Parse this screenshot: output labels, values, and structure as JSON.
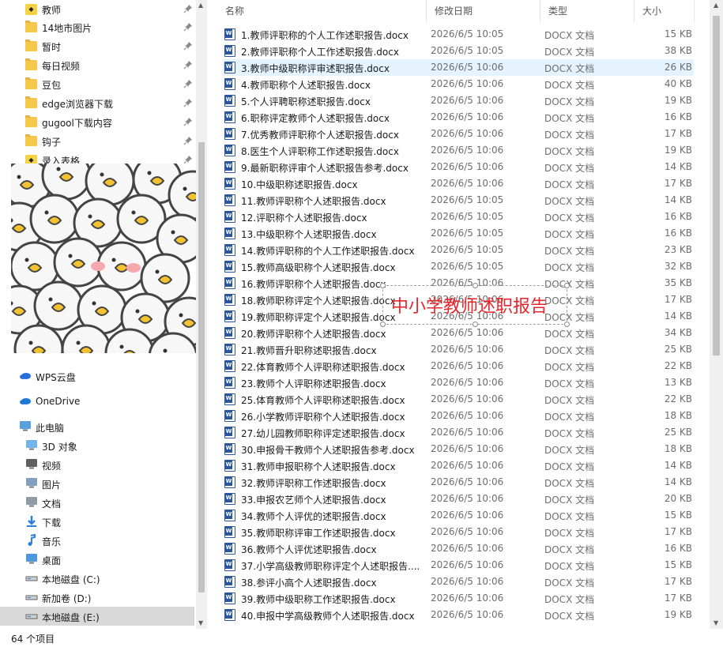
{
  "quick_access": [
    {
      "label": "教师",
      "icon": "app-icon"
    },
    {
      "label": "14地市图片",
      "icon": "folder-icon"
    },
    {
      "label": "暂时",
      "icon": "folder-icon"
    },
    {
      "label": "每日视频",
      "icon": "folder-icon"
    },
    {
      "label": "豆包",
      "icon": "folder-icon"
    },
    {
      "label": "edge浏览器下载",
      "icon": "folder-icon"
    },
    {
      "label": "gugool下载内容",
      "icon": "folder-icon"
    },
    {
      "label": "钩子",
      "icon": "folder-icon"
    },
    {
      "label": "录入表格",
      "icon": "app-icon"
    }
  ],
  "tree": [
    {
      "label": "WPS云盘",
      "icon": "wps-cloud-icon",
      "indent": 1
    },
    {
      "label": "OneDrive",
      "icon": "onedrive-icon",
      "indent": 1
    },
    {
      "label": "此电脑",
      "icon": "this-pc-icon",
      "indent": 1
    },
    {
      "label": "3D 对象",
      "icon": "3d-objects-icon",
      "indent": 2
    },
    {
      "label": "视频",
      "icon": "videos-icon",
      "indent": 2
    },
    {
      "label": "图片",
      "icon": "pictures-icon",
      "indent": 2
    },
    {
      "label": "文档",
      "icon": "documents-icon",
      "indent": 2
    },
    {
      "label": "下载",
      "icon": "downloads-icon",
      "indent": 2
    },
    {
      "label": "音乐",
      "icon": "music-icon",
      "indent": 2
    },
    {
      "label": "桌面",
      "icon": "desktop-icon",
      "indent": 2
    },
    {
      "label": "本地磁盘 (C:)",
      "icon": "drive-c-icon",
      "indent": 2
    },
    {
      "label": "新加卷 (D:)",
      "icon": "drive-d-icon",
      "indent": 2
    },
    {
      "label": "本地磁盘 (E:)",
      "icon": "drive-e-icon",
      "indent": 2,
      "selected": true
    }
  ],
  "columns": {
    "name": "名称",
    "date": "修改日期",
    "type": "类型",
    "size": "大小"
  },
  "files": [
    {
      "name": "1.教师评职称的个人工作述职报告.docx",
      "date": "2026/6/5 10:05",
      "type": "DOCX 文档",
      "size": "15 KB"
    },
    {
      "name": "2.教师评职称个人工作述职报告.docx",
      "date": "2026/6/5 10:05",
      "type": "DOCX 文档",
      "size": "38 KB"
    },
    {
      "name": "3.教师中级职称评审述职报告.docx",
      "date": "2026/6/5 10:06",
      "type": "DOCX 文档",
      "size": "26 KB",
      "selected": true
    },
    {
      "name": "4.教师职称个人述职报告.docx",
      "date": "2026/6/5 10:06",
      "type": "DOCX 文档",
      "size": "40 KB"
    },
    {
      "name": "5.个人评聘职称述职报告.docx",
      "date": "2026/6/5 10:06",
      "type": "DOCX 文档",
      "size": "19 KB"
    },
    {
      "name": "6.职称评定教师个人述职报告.docx",
      "date": "2026/6/5 10:06",
      "type": "DOCX 文档",
      "size": "16 KB"
    },
    {
      "name": "7.优秀教师评职称个人述职报告.docx",
      "date": "2026/6/5 10:06",
      "type": "DOCX 文档",
      "size": "17 KB"
    },
    {
      "name": "8.医生个人评职称工作述职报告.docx",
      "date": "2026/6/5 10:06",
      "type": "DOCX 文档",
      "size": "19 KB"
    },
    {
      "name": "9.最新职称评审个人述职报告参考.docx",
      "date": "2026/6/5 10:06",
      "type": "DOCX 文档",
      "size": "14 KB"
    },
    {
      "name": "10.中级职称述职报告.docx",
      "date": "2026/6/5 10:06",
      "type": "DOCX 文档",
      "size": "17 KB"
    },
    {
      "name": "11.教师评职称个人述职报告.docx",
      "date": "2026/6/5 10:05",
      "type": "DOCX 文档",
      "size": "14 KB"
    },
    {
      "name": "12.评职称个人述职报告.docx",
      "date": "2026/6/5 10:05",
      "type": "DOCX 文档",
      "size": "16 KB"
    },
    {
      "name": "13.中级职称个人述职报告.docx",
      "date": "2026/6/5 10:05",
      "type": "DOCX 文档",
      "size": "16 KB"
    },
    {
      "name": "14.教师评职称的个人工作述职报告.docx",
      "date": "2026/6/5 10:05",
      "type": "DOCX 文档",
      "size": "23 KB"
    },
    {
      "name": "15.教师高级职称个人述职报告.docx",
      "date": "2026/6/5 10:05",
      "type": "DOCX 文档",
      "size": "32 KB"
    },
    {
      "name": "16.教师评职称个人述职报告.docx",
      "date": "2026/6/5 10:06",
      "type": "DOCX 文档",
      "size": "35 KB"
    },
    {
      "name": "18.教师职称评定个人述职报告.docx",
      "date": "2026/6/5 10:06",
      "type": "DOCX 文档",
      "size": "17 KB"
    },
    {
      "name": "19.教师职称评定个人述职报告.docx",
      "date": "2026/6/5 10:06",
      "type": "DOCX 文档",
      "size": "14 KB"
    },
    {
      "name": "20.教师评职称个人述职报告.docx",
      "date": "2026/6/5 10:06",
      "type": "DOCX 文档",
      "size": "34 KB"
    },
    {
      "name": "21.教师晋升职称述职报告.docx",
      "date": "2026/6/5 10:06",
      "type": "DOCX 文档",
      "size": "25 KB"
    },
    {
      "name": "22.体育教师个人评职称述职报告.docx",
      "date": "2026/6/5 10:06",
      "type": "DOCX 文档",
      "size": "22 KB"
    },
    {
      "name": "23.教师个人评职称述职报告.docx",
      "date": "2026/6/5 10:06",
      "type": "DOCX 文档",
      "size": "13 KB"
    },
    {
      "name": "25.体育教师个人评职称述职报告.docx",
      "date": "2026/6/5 10:06",
      "type": "DOCX 文档",
      "size": "22 KB"
    },
    {
      "name": "26.小学教师评职称个人述职报告.docx",
      "date": "2026/6/5 10:06",
      "type": "DOCX 文档",
      "size": "18 KB"
    },
    {
      "name": "27.幼儿园教师职称评定述职报告.docx",
      "date": "2026/6/5 10:06",
      "type": "DOCX 文档",
      "size": "25 KB"
    },
    {
      "name": "30.申报骨干教师个人述职报告参考.docx",
      "date": "2026/6/5 10:06",
      "type": "DOCX 文档",
      "size": "18 KB"
    },
    {
      "name": "31.教师申报职称个人述职报告.docx",
      "date": "2026/6/5 10:06",
      "type": "DOCX 文档",
      "size": "14 KB"
    },
    {
      "name": "32.教师评职称工作述职报告.docx",
      "date": "2026/6/5 10:06",
      "type": "DOCX 文档",
      "size": "14 KB"
    },
    {
      "name": "33.申报农艺师个人述职报告.docx",
      "date": "2026/6/5 10:06",
      "type": "DOCX 文档",
      "size": "20 KB"
    },
    {
      "name": "34.教师个人评优的述职报告.docx",
      "date": "2026/6/5 10:06",
      "type": "DOCX 文档",
      "size": "15 KB"
    },
    {
      "name": "35.教师职称评审工作述职报告.docx",
      "date": "2026/6/5 10:06",
      "type": "DOCX 文档",
      "size": "17 KB"
    },
    {
      "name": "36.教师个人评优述职报告.docx",
      "date": "2026/6/5 10:06",
      "type": "DOCX 文档",
      "size": "16 KB"
    },
    {
      "name": "37.小学高级教师职称评定个人述职报告....",
      "date": "2026/6/5 10:06",
      "type": "DOCX 文档",
      "size": "15 KB"
    },
    {
      "name": "38.参评小高个人述职报告.docx",
      "date": "2026/6/5 10:06",
      "type": "DOCX 文档",
      "size": "17 KB"
    },
    {
      "name": "39.教师中级职称工作述职报告.docx",
      "date": "2026/6/5 10:06",
      "type": "DOCX 文档",
      "size": "17 KB"
    },
    {
      "name": "40.申报中学高级教师个人述职报告.docx",
      "date": "2026/6/5 10:06",
      "type": "DOCX 文档",
      "size": "19 KB"
    }
  ],
  "overlay_text": "中小学教师述职报告",
  "status": {
    "item_count": "64 个项目"
  },
  "colors": {
    "selection": "#e5f3ff",
    "word_blue": "#2b579a",
    "overlay_red": "#e5262a",
    "folder": "#f5c84c"
  }
}
